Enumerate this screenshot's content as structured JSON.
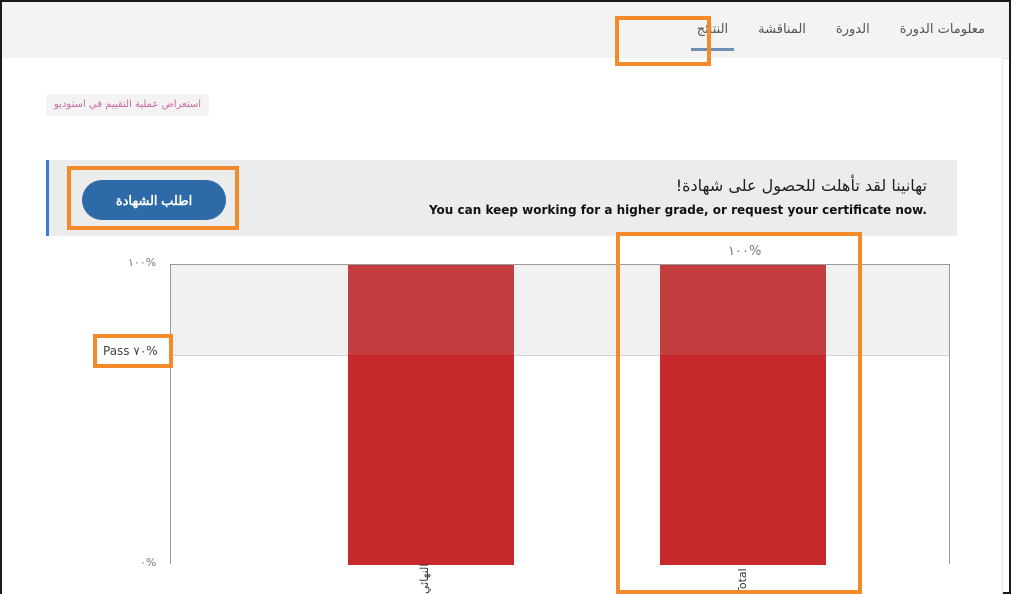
{
  "nav": {
    "tabs": [
      {
        "label": "معلومات الدورة",
        "active": false
      },
      {
        "label": "الدورة",
        "active": false
      },
      {
        "label": "المناقشة",
        "active": false
      },
      {
        "label": "النتائج",
        "active": true
      }
    ]
  },
  "staff_link": "استعراض عملية التقييم في استوديو",
  "banner": {
    "title": "تهانينا لقد تأهلت للحصول على شهادة!",
    "subtitle": "You can keep working for a higher grade, or request your certificate now.",
    "button_label": "اطلب الشهادة"
  },
  "chart_data": {
    "type": "bar",
    "categories": [
      "النهائي",
      "Total"
    ],
    "values": [
      100,
      100
    ],
    "value_labels": [
      "",
      "١٠٠%"
    ],
    "ylim": [
      0,
      100
    ],
    "y_tick_labels": {
      "top": "١٠٠%",
      "bottom": "٠%"
    },
    "pass_threshold": 70,
    "pass_label": "Pass ٧٠%",
    "colors": {
      "bar": "#c6282b",
      "bar_above_pass": "#c43d3f",
      "pass_band": "#f1f1f1"
    }
  },
  "colors": {
    "accent": "#2f6aa8",
    "highlight": "#f48a2a",
    "banner_border": "#3a7ad8"
  }
}
